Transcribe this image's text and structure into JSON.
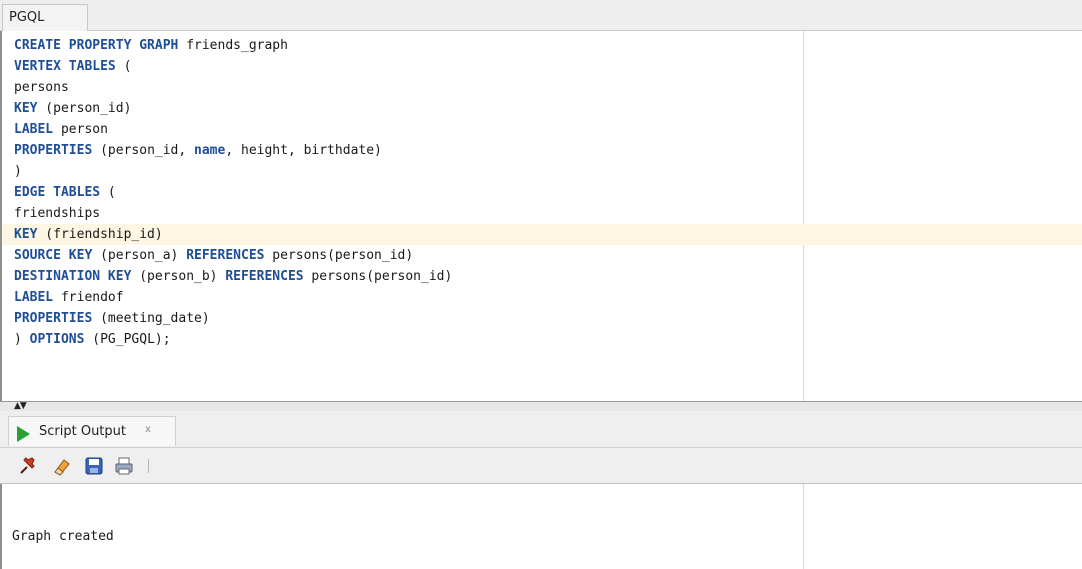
{
  "editor_tab": {
    "label": "PGQL"
  },
  "editor": {
    "lines": [
      [
        {
          "t": "CREATE PROPERTY GRAPH",
          "k": true
        },
        {
          "t": " friends_graph",
          "k": false
        }
      ],
      [
        {
          "t": "VERTEX TABLES",
          "k": true
        },
        {
          "t": " (",
          "k": false
        }
      ],
      [
        {
          "t": "persons",
          "k": false
        }
      ],
      [
        {
          "t": "KEY",
          "k": true
        },
        {
          "t": " (person_id)",
          "k": false
        }
      ],
      [
        {
          "t": "LABEL",
          "k": true
        },
        {
          "t": " person",
          "k": false
        }
      ],
      [
        {
          "t": "PROPERTIES",
          "k": true
        },
        {
          "t": " (person_id, ",
          "k": false
        },
        {
          "t": "name",
          "k": true
        },
        {
          "t": ", height, birthdate)",
          "k": false
        }
      ],
      [
        {
          "t": ")",
          "k": false
        }
      ],
      [
        {
          "t": "EDGE TABLES",
          "k": true
        },
        {
          "t": " (",
          "k": false
        }
      ],
      [
        {
          "t": "friendships",
          "k": false
        }
      ],
      [
        {
          "t": "KEY",
          "k": true
        },
        {
          "t": " (friendship_id)",
          "k": false
        }
      ],
      [
        {
          "t": "SOURCE KEY",
          "k": true
        },
        {
          "t": " (person_a) ",
          "k": false
        },
        {
          "t": "REFERENCES",
          "k": true
        },
        {
          "t": " persons(person_id)",
          "k": false
        }
      ],
      [
        {
          "t": "DESTINATION KEY",
          "k": true
        },
        {
          "t": " (person_b) ",
          "k": false
        },
        {
          "t": "REFERENCES",
          "k": true
        },
        {
          "t": " persons(person_id)",
          "k": false
        }
      ],
      [
        {
          "t": "LABEL",
          "k": true
        },
        {
          "t": " friendof",
          "k": false
        }
      ],
      [
        {
          "t": "PROPERTIES",
          "k": true
        },
        {
          "t": " (meeting_date)",
          "k": false
        }
      ],
      [
        {
          "t": ") ",
          "k": false
        },
        {
          "t": "OPTIONS",
          "k": true
        },
        {
          "t": " (PG_PGQL);",
          "k": false
        }
      ]
    ],
    "highlighted_line": 9
  },
  "output_tab": {
    "label": "Script Output",
    "close_glyph": "x",
    "icon": "run-icon"
  },
  "toolbar": {
    "buttons": [
      {
        "name": "pin-button",
        "icon": "pin-icon"
      },
      {
        "name": "clear-button",
        "icon": "eraser-icon"
      },
      {
        "name": "save-button",
        "icon": "save-icon"
      },
      {
        "name": "print-button",
        "icon": "print-icon"
      }
    ]
  },
  "output": {
    "text": "Graph created"
  },
  "colors": {
    "keyword": "#1f4e96",
    "highlight": "#fdf6e3",
    "run": "#27a12f"
  }
}
